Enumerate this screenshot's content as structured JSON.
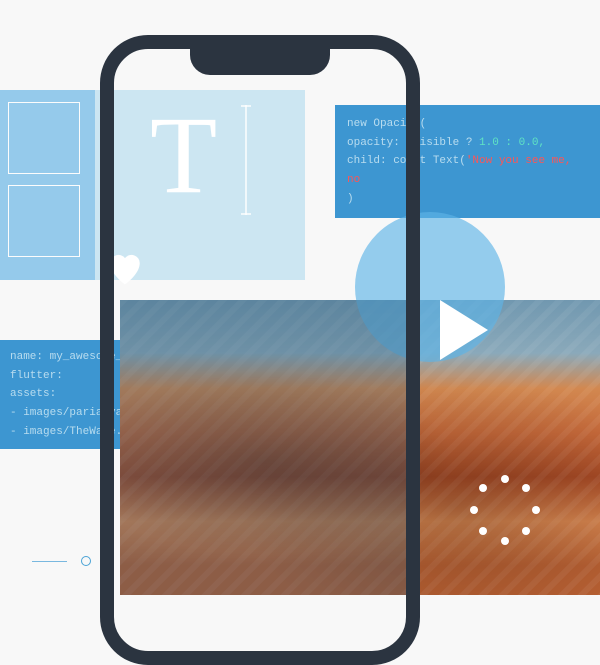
{
  "code_top": {
    "l1": "new Opacity(",
    "l2a": "  opacity: _visible ? ",
    "l2b": "1.0 : 0.0,",
    "l3a": "  child: const Text(",
    "l3b": "'Now you see me, no",
    "l4": ")"
  },
  "code_left": {
    "l1": "name: my_awesome_application",
    "l2": "flutter:",
    "l3": "  assets:",
    "l4": "    - images/pariahvalley.jpeg",
    "l5": "    - images/TheWave.jpeg"
  },
  "typography_letter": "T"
}
